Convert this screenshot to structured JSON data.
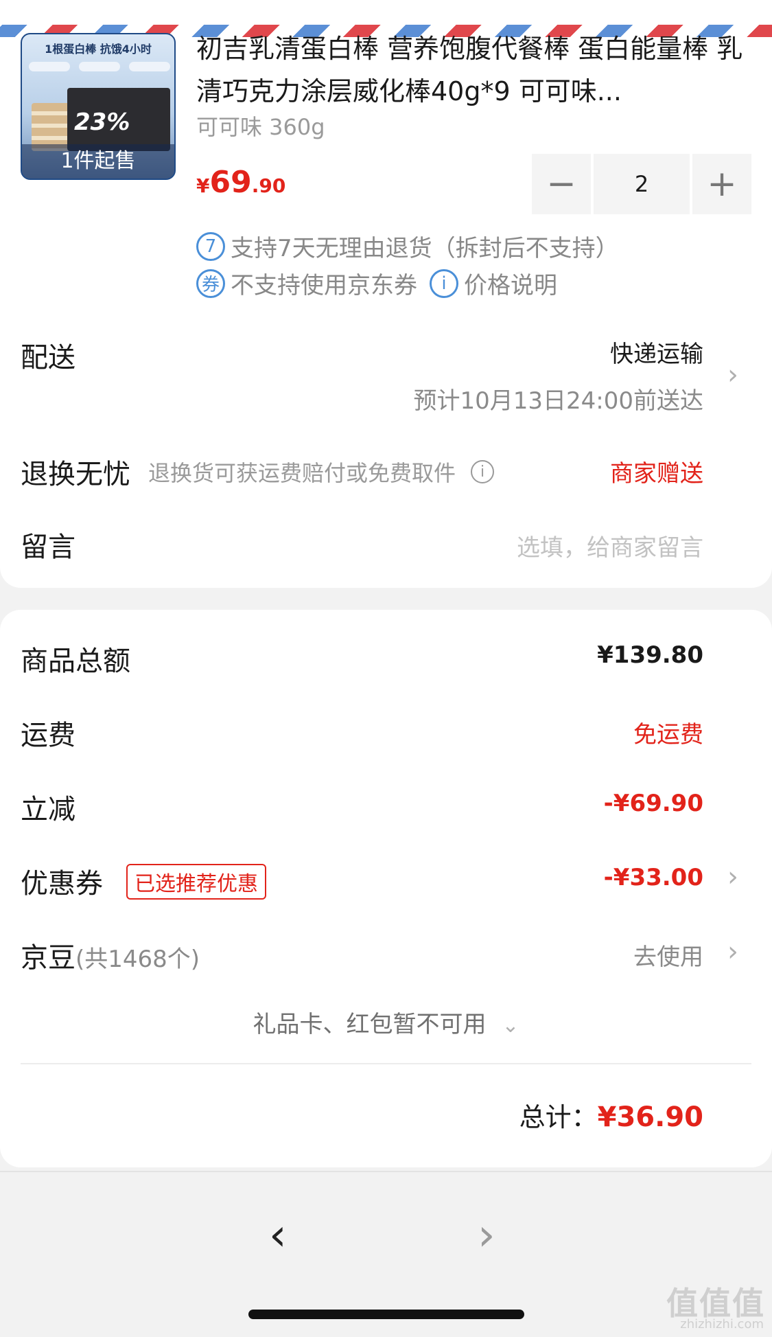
{
  "product": {
    "thumb_banner": "1根蛋白棒 抗饿4小时",
    "thumb_box_text": "23%",
    "thumb_overlay": "1件起售",
    "title": "初吉乳清蛋白棒 营养饱腹代餐棒 蛋白能量棒 乳清巧克力涂层威化棒40g*9 可可味...",
    "spec": "可可味 360g",
    "price_currency": "¥",
    "price_int": "69",
    "price_dec": ".90",
    "quantity": "2",
    "minus": "−",
    "plus": "+",
    "service_return_icon": "7",
    "service_return": "支持7天无理由退货（拆封后不支持）",
    "service_coupon_icon": "券",
    "service_coupon": "不支持使用京东券",
    "price_info_icon": "i",
    "price_info": "价格说明"
  },
  "delivery": {
    "label": "配送",
    "method": "快递运输",
    "eta": "预计10月13日24:00前送达"
  },
  "return_service": {
    "label": "退换无忧",
    "desc": "退换货可获运费赔付或免费取件",
    "value": "商家赠送"
  },
  "message": {
    "label": "留言",
    "placeholder": "选填，给商家留言"
  },
  "summary": {
    "goods_total_label": "商品总额",
    "goods_total": "¥139.80",
    "shipping_label": "运费",
    "shipping": "免运费",
    "discount_label": "立减",
    "discount": "-¥69.90",
    "coupon_label": "优惠券",
    "coupon_tag": "已选推荐优惠",
    "coupon": "-¥33.00",
    "jd_bean_label": "京豆",
    "jd_bean_count": "(共1468个)",
    "jd_bean_action": "去使用",
    "giftcard_note": "礼品卡、红包暂不可用",
    "total_label": "总计：",
    "total": "¥36.90"
  },
  "nav": {
    "back": "‹",
    "forward": "›"
  },
  "watermark": {
    "text": "值值值",
    "sub": "zhizhizhi.com"
  },
  "colors": {
    "accent_red": "#e2231a",
    "info_blue": "#4a8fd8"
  }
}
